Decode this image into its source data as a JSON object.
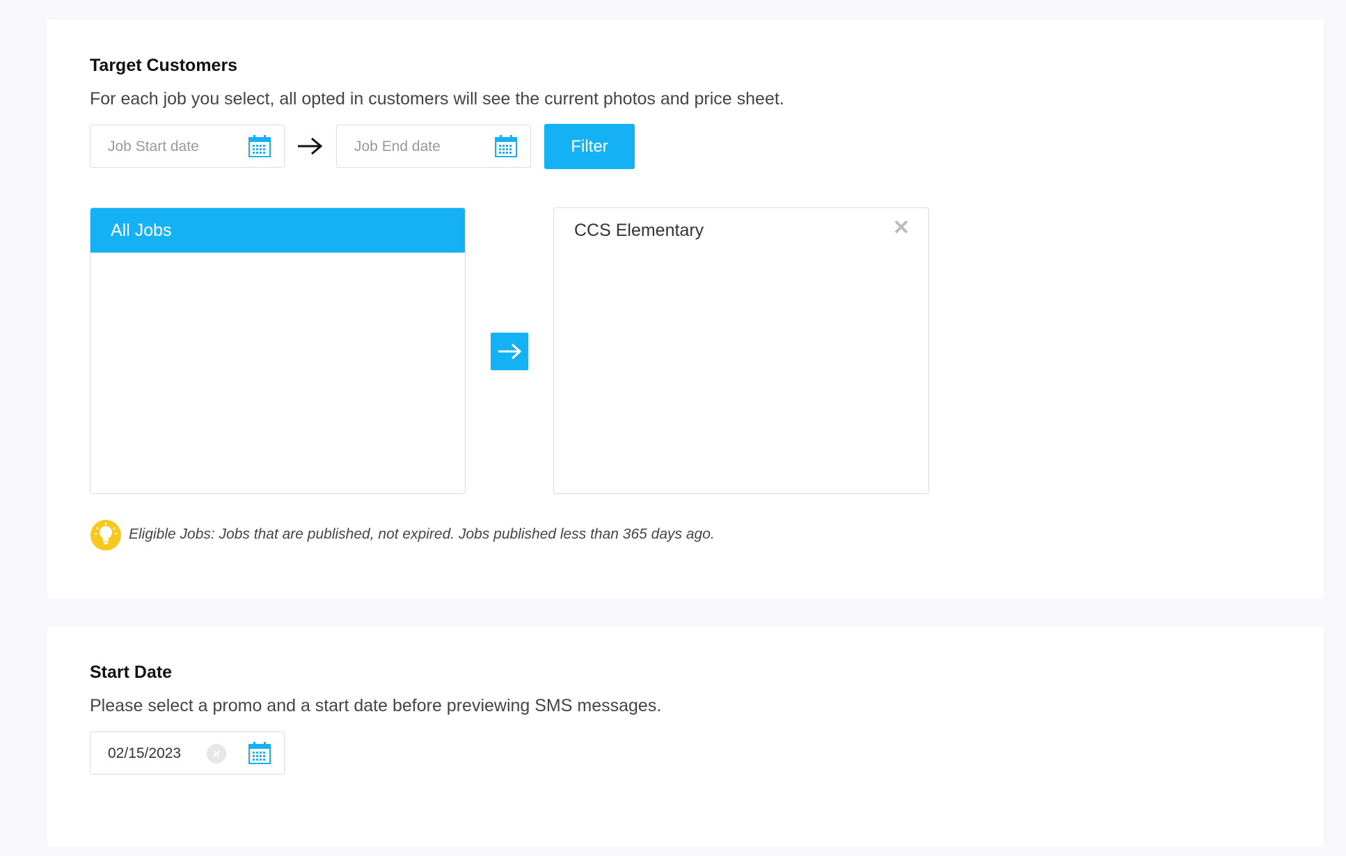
{
  "target_customers": {
    "title": "Target Customers",
    "description": "For each job you select, all opted in customers will see the current photos and price sheet.",
    "job_start_date": {
      "placeholder": "Job Start date",
      "icon": "calendar-icon"
    },
    "job_end_date": {
      "placeholder": "Job End date",
      "icon": "calendar-icon"
    },
    "filter_button": "Filter",
    "all_jobs_header": "All Jobs",
    "all_jobs_items": [],
    "selected_jobs": [
      {
        "label": "CCS Elementary",
        "icon": "close-icon"
      }
    ],
    "transfer_icon": "arrow-right-icon",
    "hint": {
      "icon": "lightbulb-icon",
      "text": "Eligible Jobs: Jobs that are published, not expired. Jobs published less than 365 days ago."
    }
  },
  "start_date": {
    "title": "Start Date",
    "description": "Please select a promo and a start date before previewing SMS messages.",
    "value": "02/15/2023",
    "clear_icon": "clear-icon",
    "icon": "calendar-icon"
  },
  "colors": {
    "accent": "#14b2f5",
    "hint_yellow": "#f7c81e",
    "background": "#f7f7fc"
  }
}
